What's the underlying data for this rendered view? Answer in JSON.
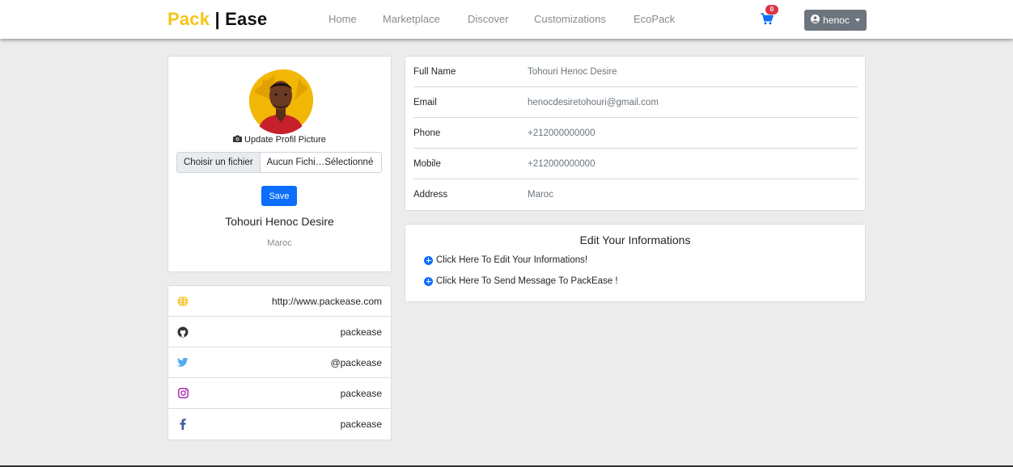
{
  "brand": {
    "part1": "Pack",
    "sep": "|",
    "part2": "Ease"
  },
  "nav": {
    "links": [
      "Home",
      "Marketplace",
      "Discover",
      "Customizations",
      "EcoPack"
    ],
    "cart_count": "0",
    "user_label": "henoc"
  },
  "profile": {
    "update_label": "Update Profil Picture",
    "file_button": "Choisir un fichier",
    "file_name": "Aucun Fichi…Sélectionné",
    "save_label": "Save",
    "name": "Tohouri Henoc Desire",
    "location": "Maroc"
  },
  "social": [
    {
      "icon": "globe-icon",
      "value": "http://www.packease.com",
      "color": "#f5b800"
    },
    {
      "icon": "github-icon",
      "value": "packease",
      "color": "#333333"
    },
    {
      "icon": "twitter-icon",
      "value": "@packease",
      "color": "#55acee"
    },
    {
      "icon": "instagram-icon",
      "value": "packease",
      "color": "#ac2bac"
    },
    {
      "icon": "facebook-icon",
      "value": "packease",
      "color": "#3b5998"
    }
  ],
  "info": [
    {
      "label": "Full Name",
      "value": "Tohouri Henoc Desire"
    },
    {
      "label": "Email",
      "value": "henocdesiretohouri@gmail.com"
    },
    {
      "label": "Phone",
      "value": "+212000000000"
    },
    {
      "label": "Mobile",
      "value": "+212000000000"
    },
    {
      "label": "Address",
      "value": "Maroc"
    }
  ],
  "edit": {
    "title": "Edit Your Informations",
    "link_edit": "Click Here To Edit Your Informations!",
    "link_message": "Click Here To Send Message To PackEase !"
  },
  "colors": {
    "brand_yellow": "#f5c518",
    "primary": "#0d6efd",
    "badge": "#dc3545",
    "user_button": "#6c757d"
  }
}
